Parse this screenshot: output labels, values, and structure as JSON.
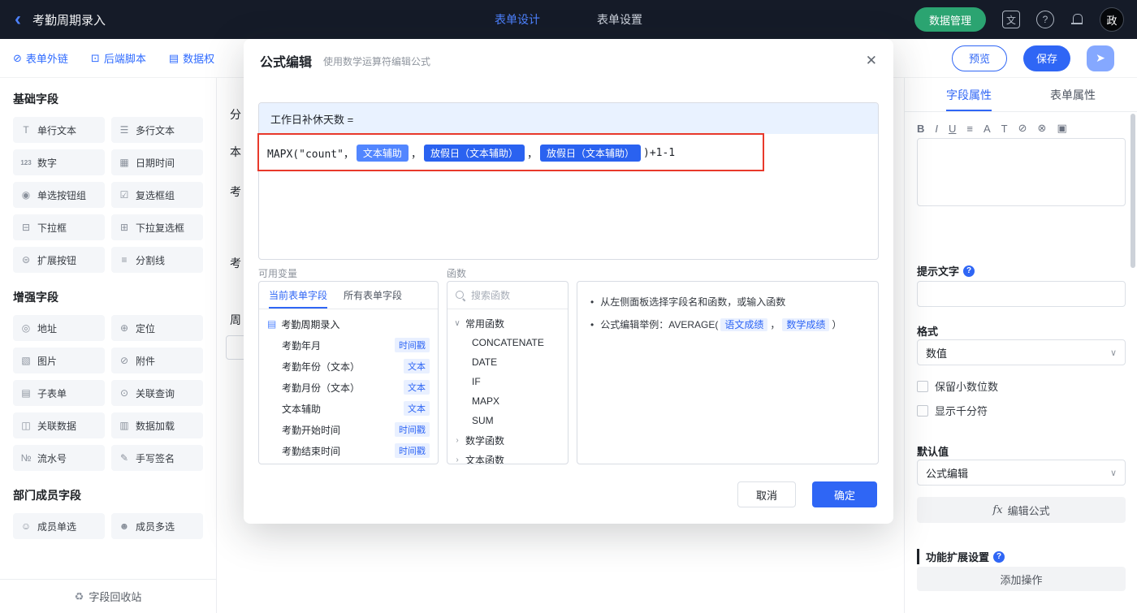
{
  "colors": {
    "accent": "#2F66F5",
    "topbar_bg": "#151B28",
    "green": "#2BA471",
    "annotation_red": "#E8392B",
    "chip_blue": "#2A62F0",
    "chip_light_blue": "#5286FF",
    "badge_bg": "#E9F0FF"
  },
  "topbar": {
    "back_icon": "‹",
    "title": "考勤周期录入",
    "tabs": [
      {
        "label": "表单设计"
      },
      {
        "label": "表单设置"
      }
    ],
    "data_button": "数据管理",
    "lang_icon": "文",
    "help_icon": "?",
    "avatar_text": "政"
  },
  "toolbar": {
    "links": [
      {
        "icon": "⊘",
        "label": "表单外链"
      },
      {
        "icon": "⊡",
        "label": "后端脚本"
      },
      {
        "icon": "▤",
        "label": "数据权"
      }
    ],
    "preview": "预览",
    "save": "保存",
    "share_icon": "➤"
  },
  "sidebar": {
    "sections": [
      {
        "title": "基础字段",
        "items": [
          {
            "icon": "T",
            "label": "单行文本"
          },
          {
            "icon": "☰",
            "label": "多行文本"
          },
          {
            "icon": "123",
            "label": "数字"
          },
          {
            "icon": "▦",
            "label": "日期时间"
          },
          {
            "icon": "◉",
            "label": "单选按钮组"
          },
          {
            "icon": "☑",
            "label": "复选框组"
          },
          {
            "icon": "⊟",
            "label": "下拉框"
          },
          {
            "icon": "⊞",
            "label": "下拉复选框"
          },
          {
            "icon": "⊜",
            "label": "扩展按钮"
          },
          {
            "icon": "≡",
            "label": "分割线"
          }
        ]
      },
      {
        "title": "增强字段",
        "items": [
          {
            "icon": "◎",
            "label": "地址"
          },
          {
            "icon": "⊕",
            "label": "定位"
          },
          {
            "icon": "▧",
            "label": "图片"
          },
          {
            "icon": "⊘",
            "label": "附件"
          },
          {
            "icon": "▤",
            "label": "子表单"
          },
          {
            "icon": "⊙",
            "label": "关联查询"
          },
          {
            "icon": "◫",
            "label": "关联数据"
          },
          {
            "icon": "▥",
            "label": "数据加载"
          },
          {
            "icon": "№",
            "label": "流水号"
          },
          {
            "icon": "✎",
            "label": "手写签名"
          }
        ]
      },
      {
        "title": "部门成员字段",
        "items": [
          {
            "icon": "☺",
            "label": "成员单选"
          },
          {
            "icon": "☻",
            "label": "成员多选"
          }
        ]
      }
    ],
    "recycle_icon": "♻",
    "recycle_label": "字段回收站"
  },
  "canvas": {
    "fragments": [
      "分",
      "本",
      "考",
      "考",
      "周"
    ]
  },
  "rightpanel": {
    "tabs": [
      {
        "label": "字段属性"
      },
      {
        "label": "表单属性"
      }
    ],
    "rt_icons": [
      "B",
      "I",
      "U",
      "≡",
      "A",
      "T",
      "⊘",
      "⊗",
      "▣"
    ],
    "hint_label": "提示文字",
    "format_label": "格式",
    "format_value": "数值",
    "checkbox1": "保留小数位数",
    "checkbox2": "显示千分符",
    "default_label": "默认值",
    "default_value": "公式编辑",
    "fx_icon": "fx",
    "fx_label": "编辑公式",
    "ext_label": "功能扩展设置",
    "add_action": "添加操作",
    "chevron": "∨"
  },
  "modal": {
    "title": "公式编辑",
    "subtitle": "使用数学运算符编辑公式",
    "close_icon": "✕",
    "target_label": "工作日补休天数 =",
    "formula": {
      "parts": [
        {
          "text": "MAPX(\"count\"，"
        },
        {
          "text": "文本辅助"
        },
        {
          "text": "，"
        },
        {
          "text": "放假日（文本辅助）"
        },
        {
          "text": "，"
        },
        {
          "text": "放假日（文本辅助）"
        },
        {
          "text": ")+1-1"
        }
      ]
    },
    "vars": {
      "label": "可用变量",
      "tab_current": "当前表单字段",
      "tab_all": "所有表单字段",
      "root_icon": "▤",
      "root": "考勤周期录入",
      "items": [
        {
          "label": "考勤年月",
          "badge": "时间戳"
        },
        {
          "label": "考勤年份（文本）",
          "badge": "文本"
        },
        {
          "label": "考勤月份（文本）",
          "badge": "文本"
        },
        {
          "label": "文本辅助",
          "badge": "文本"
        },
        {
          "label": "考勤开始时间",
          "badge": "时间戳"
        },
        {
          "label": "考勤结束时间",
          "badge": "时间戳"
        }
      ]
    },
    "funcs": {
      "label": "函数",
      "search_placeholder": "搜索函数",
      "chev_open": "∨",
      "chev_closed": "›",
      "group_common": "常用函数",
      "items": [
        "CONCATENATE",
        "DATE",
        "IF",
        "MAPX",
        "SUM"
      ],
      "group_math": "数学函数",
      "group_text": "文本函数"
    },
    "tips": {
      "bullet": "•",
      "line1": "从左侧面板选择字段名和函数，或输入函数",
      "line2_prefix": "公式编辑举例：AVERAGE(",
      "token1": "语文成绩",
      "sep": "，",
      "token2": "数学成绩",
      "line2_suffix": "）"
    },
    "cancel": "取消",
    "ok": "确定"
  }
}
